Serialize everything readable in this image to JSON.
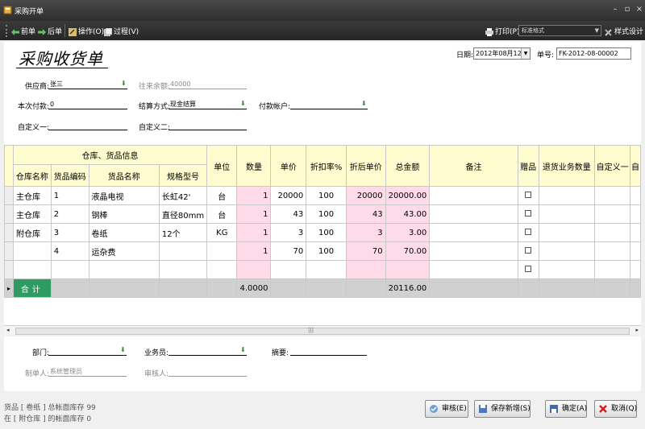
{
  "window": {
    "title": "采购开单"
  },
  "toolbar": {
    "prev": "前单",
    "next": "后单",
    "operate": "操作(O)",
    "process": "过程(V)",
    "print": "打印(P)",
    "style_value": "标准格式",
    "style_design": "样式设计"
  },
  "header": {
    "doc_title": "采购收货单",
    "date_label": "日期:",
    "date_value": "2012年08月12日",
    "no_label": "单号:",
    "no_value": "FK-2012-08-00002"
  },
  "form": {
    "supplier_label": "供应商:",
    "supplier_value": "张三",
    "balance_label": "往来余额:",
    "balance_value": "40000",
    "payment_label": "本次付款:",
    "payment_value": "0",
    "settle_label": "结算方式:",
    "settle_value": "现金结算",
    "account_label": "付款帐户:",
    "account_value": "",
    "custom1_label": "自定义一:",
    "custom1_value": "",
    "custom2_label": "自定义二:",
    "custom2_value": ""
  },
  "table": {
    "group_header": "仓库、货品信息",
    "headers": {
      "warehouse": "仓库名称",
      "code": "货品编码",
      "name": "货品名称",
      "spec": "规格型号",
      "unit": "单位",
      "qty": "数量",
      "price": "单价",
      "discount": "折扣率%",
      "disc_price": "折后单价",
      "amount": "总金额",
      "remark": "备注",
      "gift": "赠品",
      "return_qty": "退货业务数量",
      "custom1": "自定义一",
      "more": "自"
    },
    "rows": [
      {
        "warehouse": "主仓库",
        "code": "1",
        "name": "液晶电视",
        "spec": "长虹42'",
        "unit": "台",
        "qty": "1",
        "price": "20000",
        "discount": "100",
        "disc_price": "20000",
        "amount": "20000.00"
      },
      {
        "warehouse": "主仓库",
        "code": "2",
        "name": "钢棒",
        "spec": "直径80mm",
        "unit": "台",
        "qty": "1",
        "price": "43",
        "discount": "100",
        "disc_price": "43",
        "amount": "43.00"
      },
      {
        "warehouse": "附仓库",
        "code": "3",
        "name": "卷纸",
        "spec": "12个",
        "unit": "KG",
        "qty": "1",
        "price": "3",
        "discount": "100",
        "disc_price": "3",
        "amount": "3.00"
      },
      {
        "warehouse": "",
        "code": "4",
        "name": "运杂费",
        "spec": "",
        "unit": "",
        "qty": "1",
        "price": "70",
        "discount": "100",
        "disc_price": "70",
        "amount": "70.00"
      },
      {
        "warehouse": "",
        "code": "",
        "name": "",
        "spec": "",
        "unit": "",
        "qty": "",
        "price": "",
        "discount": "",
        "disc_price": "",
        "amount": ""
      }
    ],
    "total": {
      "label": "合计",
      "qty": "4.0000",
      "amount": "20116.00"
    }
  },
  "footer": {
    "dept_label": "部门:",
    "dept_value": "",
    "staff_label": "业务员:",
    "staff_value": "",
    "summary_label": "摘要:",
    "summary_value": "",
    "maker_label": "制单人:",
    "maker_value": "系统管理员",
    "auditor_label": "审核人:",
    "auditor_value": ""
  },
  "status": {
    "line1": "货品 [ 卷纸 ] 总帐面库存 99",
    "line2": "在 [ 附仓库 ] 的帐面库存 0"
  },
  "buttons": {
    "audit": "审核(E)",
    "save_new": "保存新增(S)",
    "ok": "确定(A)",
    "cancel": "取消(Q)"
  },
  "colors": {
    "header_bg": "#fffdd0",
    "pink_cell": "#ffdbea",
    "total_label_bg": "#2e9c62"
  }
}
